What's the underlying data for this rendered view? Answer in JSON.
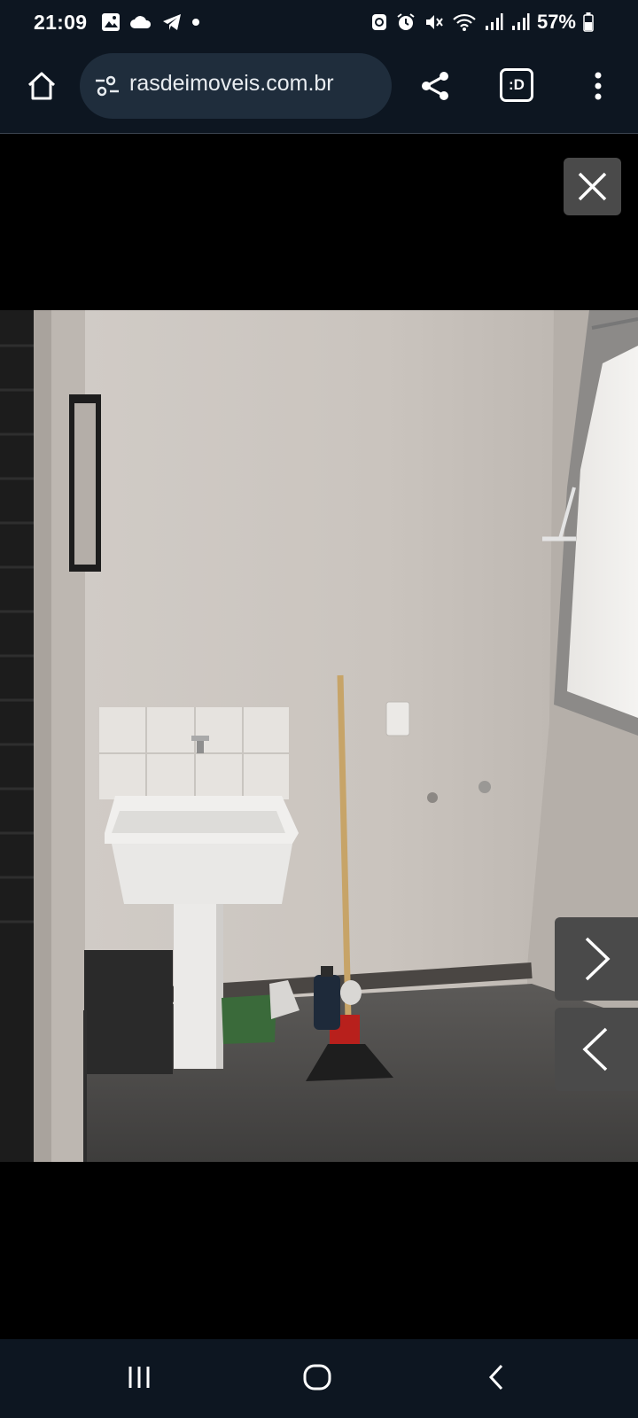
{
  "status_bar": {
    "time": "21:09",
    "left_icons": [
      "gallery-icon",
      "cloud-icon",
      "telegram-icon",
      "dot-icon"
    ],
    "right_icons": [
      "sync-icon",
      "alarm-icon",
      "mute-icon",
      "wifi-icon",
      "signal-icon",
      "signal-icon"
    ],
    "battery_text": "57%",
    "battery_level": 0.57
  },
  "toolbar": {
    "home_icon": "home-icon",
    "url": "rasdeimoveis.com.br",
    "site_settings_icon": "site-settings-icon",
    "share_icon": "share-icon",
    "tab_switcher_text": ":D",
    "menu_icon": "more-vert-icon"
  },
  "viewer": {
    "close_icon": "close-icon",
    "next_icon": "chevron-right-icon",
    "prev_icon": "chevron-left-icon"
  },
  "nav_bar": {
    "recents_icon": "recents-icon",
    "home_icon": "home-circle-icon",
    "back_icon": "back-icon"
  },
  "colors": {
    "bar_bg": "#0d1621",
    "pill_bg": "#1f2d3c",
    "overlay_btn": "#4a4a4a"
  }
}
